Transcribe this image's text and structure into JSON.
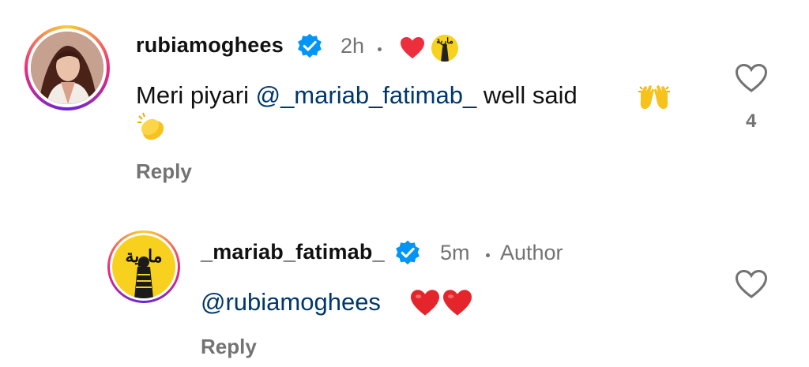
{
  "comments": [
    {
      "username": "rubiamoghees",
      "time": "2h",
      "text_prefix": "Meri piyari ",
      "mention": "@_mariab_fatimab_",
      "text_suffix": " well said",
      "reply_label": "Reply",
      "like_count": "4"
    },
    {
      "username": "_mariab_fatimab_",
      "time": "5m",
      "author_tag": "Author",
      "mention": "@rubiamoghees",
      "reply_label": "Reply"
    }
  ],
  "logo_text": "مارية",
  "colors": {
    "verified": "#0095f6",
    "mention": "#00376b",
    "heart": "#ed4956",
    "meta": "#737373"
  },
  "icons": [
    "verified-badge-icon",
    "heart-icon",
    "like-heart-outline-icon",
    "raising-hands-emoji",
    "clapping-hands-emoji",
    "red-heart-emoji"
  ]
}
